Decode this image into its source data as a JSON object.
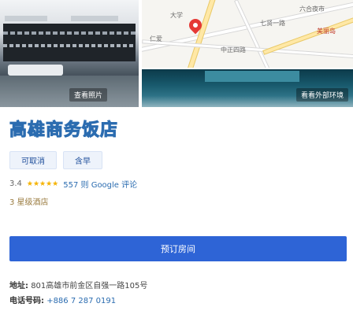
{
  "photos": {
    "view_photos_label": "查看照片",
    "view_street_label": "看看外部环境"
  },
  "map": {
    "labels": [
      "大学",
      "六合夜市",
      "美丽岛",
      "中正四路",
      "七贤一路",
      "仁爱"
    ]
  },
  "hotel": {
    "name": "高雄商务饭店",
    "tags": [
      "可取消",
      "含早"
    ],
    "rating": "3.4",
    "stars_display": "★★★★★",
    "reviews_link": "557 则 Google 评论",
    "star_class": "3 星级酒店"
  },
  "actions": {
    "book_label": "预订房间"
  },
  "contact": {
    "address_label": "地址:",
    "address_value": "801高雄市前金区自强一路105号",
    "phone_label": "电话号码:",
    "phone_value": "+886 7 287 0191"
  },
  "colors": {
    "primary": "#2e64d6",
    "link": "#2b6cb0",
    "star": "#f5b301"
  }
}
